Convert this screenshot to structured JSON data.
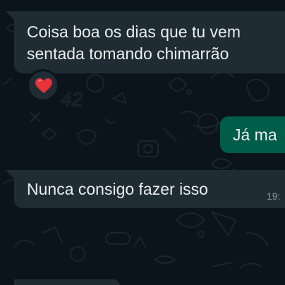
{
  "chat": {
    "messages": [
      {
        "direction": "incoming",
        "text": "Coisa boa os dias que tu vem\nsentada tomando chimarrão",
        "reaction": {
          "icon": "heart-icon",
          "color": "#e8323c"
        }
      },
      {
        "direction": "outgoing",
        "text": "Já ma"
      },
      {
        "direction": "incoming",
        "text": "Nunca consigo fazer isso",
        "time": "19:"
      }
    ]
  },
  "theme": {
    "background": "#0b141a",
    "incoming_bubble": "#202c33",
    "outgoing_bubble": "#005c4b",
    "text": "#e9edef",
    "meta_text": "#8696a0",
    "doodle": "#1a252c"
  },
  "wallpaper": {
    "doodle_text": "42"
  }
}
